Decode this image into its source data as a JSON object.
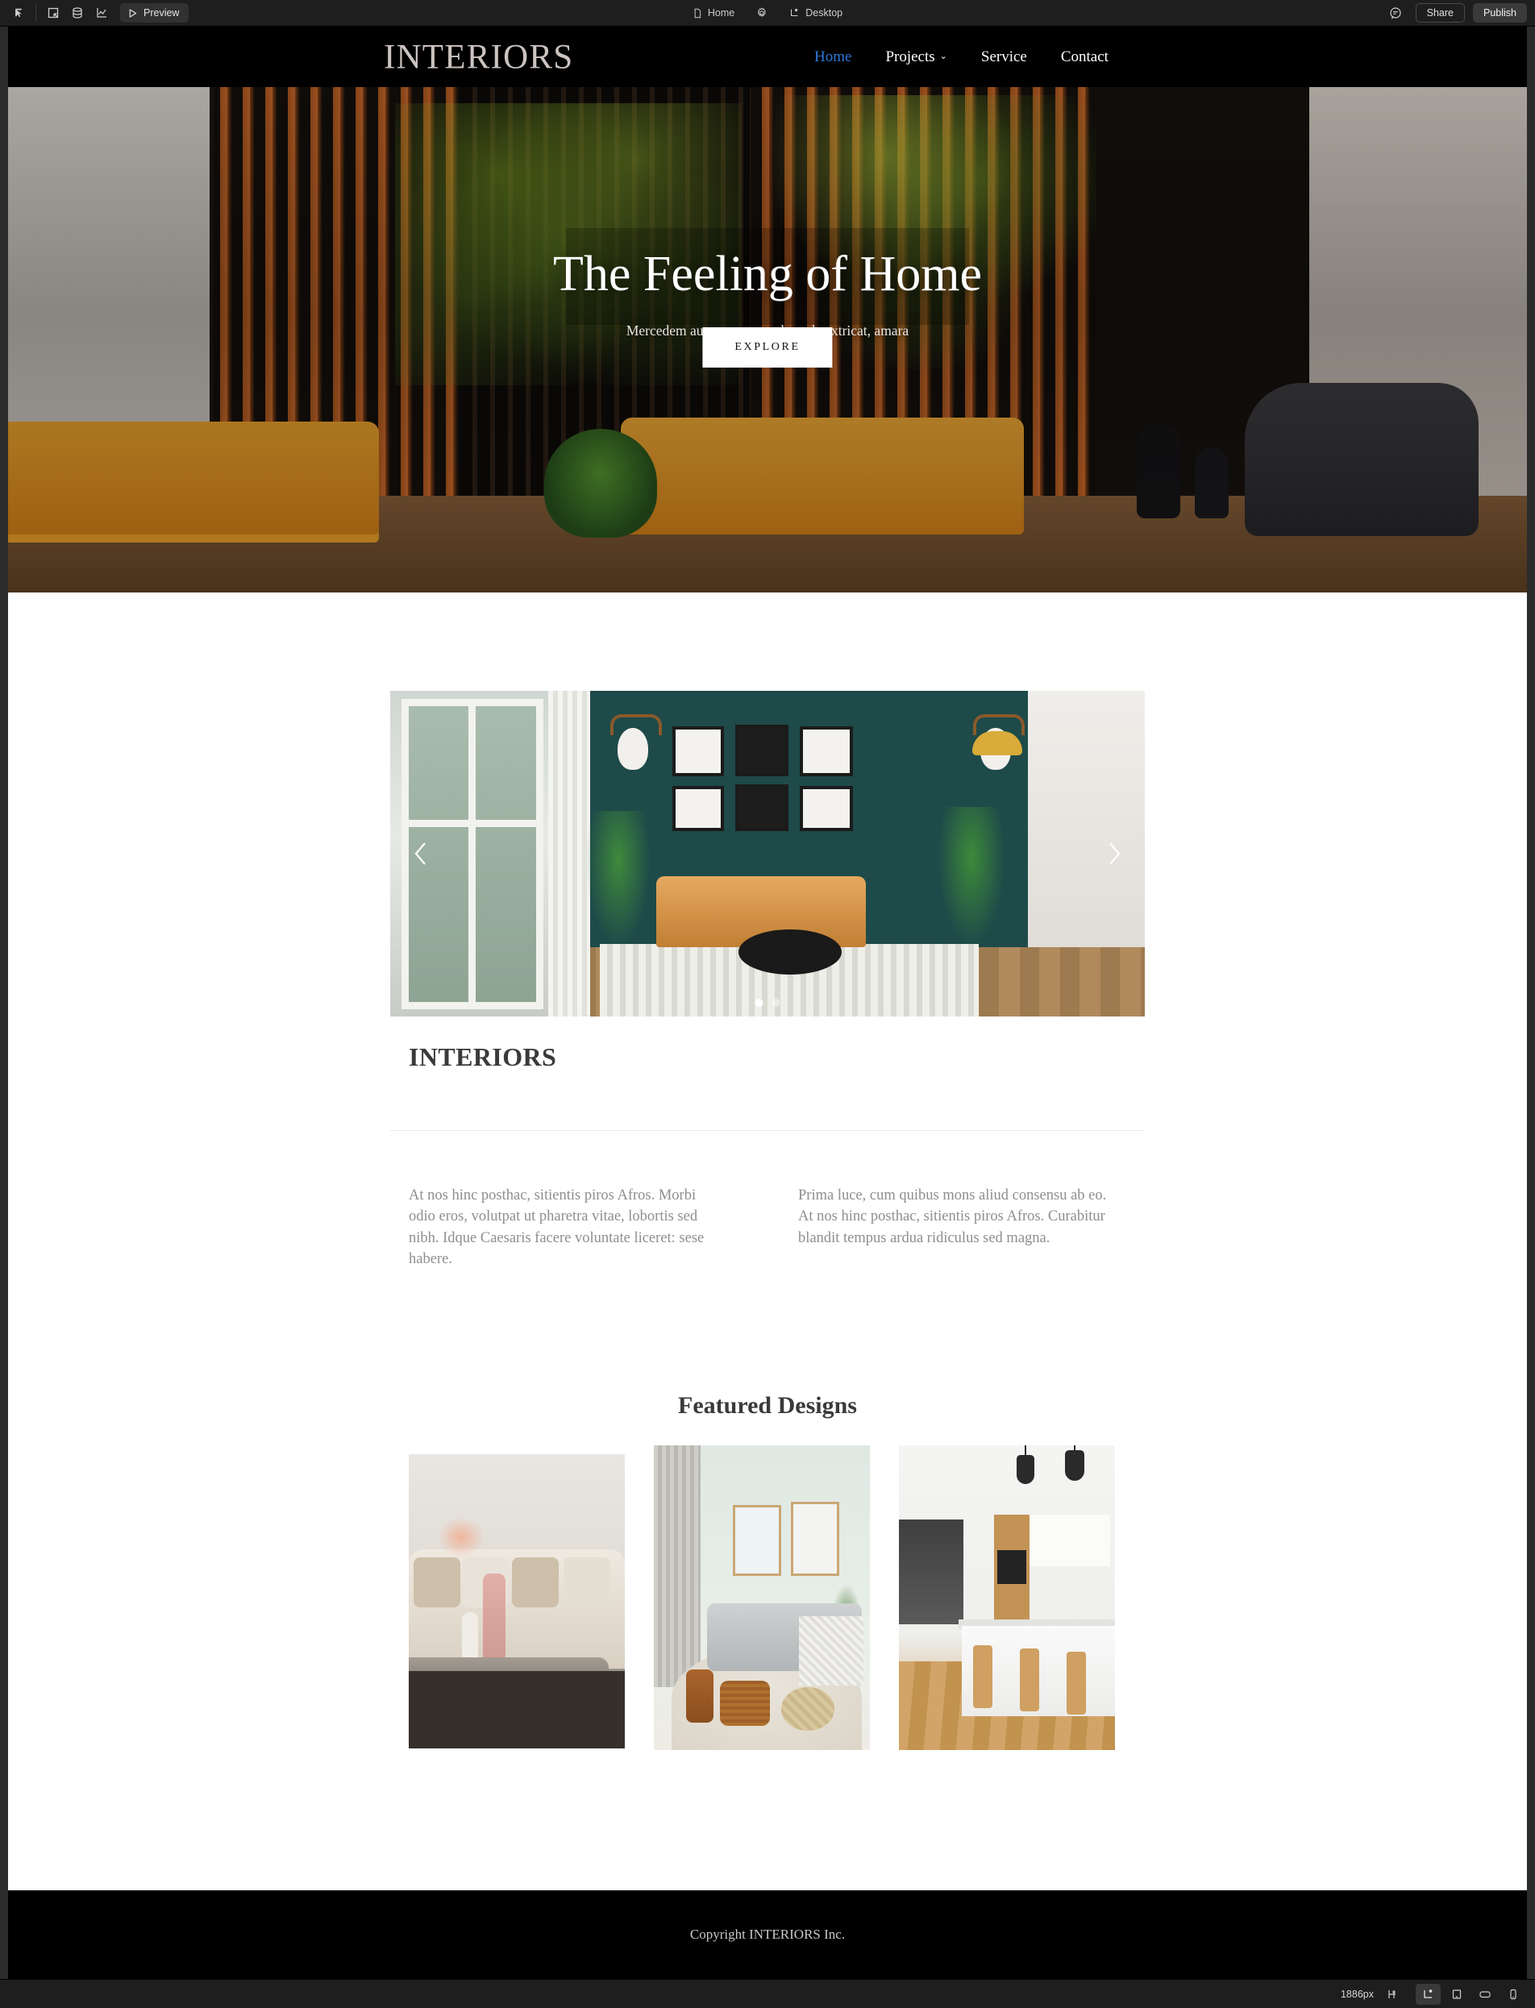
{
  "editor": {
    "topbar": {
      "tools": [
        {
          "name": "cursor-icon",
          "label": "Select"
        },
        {
          "name": "frame-icon",
          "label": "Frame"
        },
        {
          "name": "database-icon",
          "label": "Data"
        },
        {
          "name": "analytics-icon",
          "label": "Analytics"
        }
      ],
      "preview_label": "Preview",
      "page_label": "Home",
      "breakpoint_label": "Desktop",
      "share_label": "Share",
      "publish_label": "Publish"
    },
    "bottombar": {
      "width_label": "1886px",
      "viewports": [
        {
          "name": "viewport-desktop",
          "active": true
        },
        {
          "name": "viewport-laptop",
          "active": false
        },
        {
          "name": "viewport-tablet",
          "active": false
        },
        {
          "name": "viewport-mobile",
          "active": false
        }
      ]
    }
  },
  "site": {
    "nav": {
      "logo": "INTERIORS",
      "links": [
        {
          "label": "Home",
          "active": true,
          "has_dropdown": false
        },
        {
          "label": "Projects",
          "active": false,
          "has_dropdown": true
        },
        {
          "label": "Service",
          "active": false,
          "has_dropdown": false
        },
        {
          "label": "Contact",
          "active": false,
          "has_dropdown": false
        }
      ],
      "caret": "⌄"
    },
    "hero": {
      "title": "The Feeling of Home",
      "subtitle": "Mercedem aut nummos unde unde extricat, amara",
      "cta_label": "EXPLORE"
    },
    "carousel": {
      "prev_label": "‹",
      "next_label": "›",
      "slides": 2,
      "active_slide": 1
    },
    "intro": {
      "heading": "INTERIORS",
      "column_left": "At nos hinc posthac, sitientis piros Afros. Morbi odio eros, volutpat ut pharetra vitae, lobortis sed nibh. Idque Caesaris facere voluntate liceret: sese habere.",
      "column_right": "Prima luce, cum quibus mons aliud consensu ab eo. At nos hinc posthac, sitientis piros Afros. Curabitur blandit tempus ardua ridiculus sed magna."
    },
    "featured": {
      "heading": "Featured Designs",
      "cards": [
        {
          "name": "featured-card-living-room-neutral"
        },
        {
          "name": "featured-card-living-room-green"
        },
        {
          "name": "featured-card-kitchen"
        }
      ]
    },
    "footer": {
      "copyright": "Copyright INTERIORS Inc."
    },
    "colors": {
      "nav_background": "#000000",
      "logo": "#cbc3bf",
      "active_link": "#2e78d6",
      "heading": "#3a3a3a",
      "body_text": "#8e8e8e",
      "cta_background": "#ffffff"
    }
  }
}
